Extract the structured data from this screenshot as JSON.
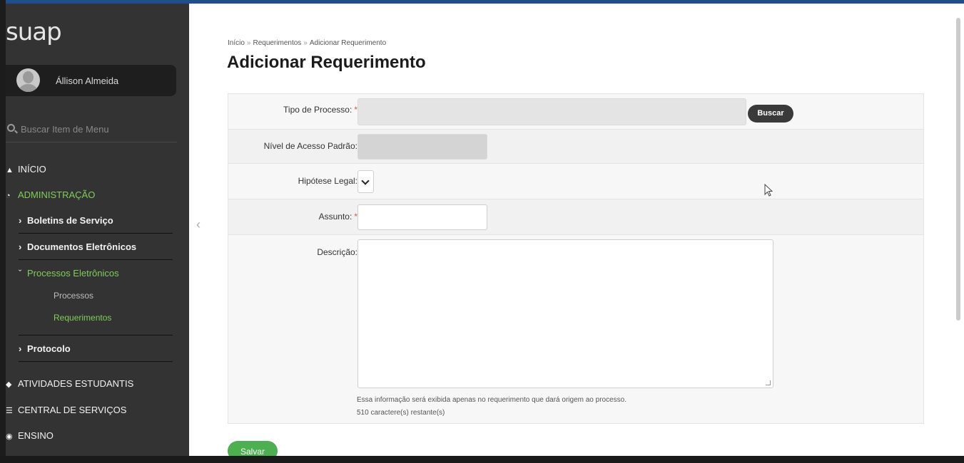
{
  "sidebar": {
    "logo": "suap",
    "user_name": "Állison Almeida",
    "search_placeholder": "Buscar Item de Menu",
    "menu": {
      "inicio": "INÍCIO",
      "administracao": "ADMINISTRAÇÃO",
      "boletins": "Boletins de Serviço",
      "documentos": "Documentos Eletrônicos",
      "processos_eletronicos": "Processos Eletrônicos",
      "processos": "Processos",
      "requerimentos": "Requerimentos",
      "protocolo": "Protocolo",
      "atividades": "ATIVIDADES ESTUDANTIS",
      "central": "CENTRAL DE SERVIÇOS",
      "ensino": "ENSINO"
    }
  },
  "breadcrumb": [
    "Início",
    "Requerimentos",
    "Adicionar Requerimento"
  ],
  "page_title": "Adicionar Requerimento",
  "form": {
    "tipo_processo_label": "Tipo de Processo:",
    "buscar_label": "Buscar",
    "nivel_acesso_label": "Nível de Acesso Padrão:",
    "hipotese_label": "Hipótese Legal:",
    "assunto_label": "Assunto:",
    "descricao_label": "Descrição:",
    "required_marker": "*",
    "help_text": "Essa informação será exibida apenas no requerimento que dará origem ao processo.",
    "chars_remaining": "510 caractere(s) restante(s)"
  },
  "save_label": "Salvar",
  "colors": {
    "accent": "#7fce5a",
    "sidebar_bg": "#333333",
    "save_button": "#4caf50"
  }
}
